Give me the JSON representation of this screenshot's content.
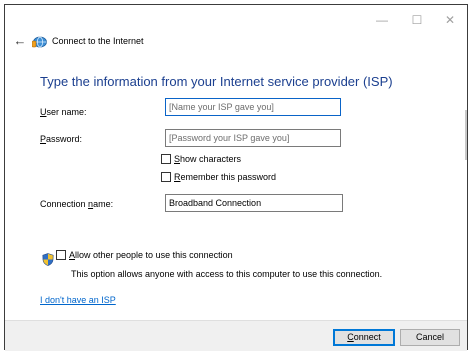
{
  "titlebar": {
    "minimize_glyph": "—",
    "maximize_glyph": "☐",
    "close_glyph": "✕"
  },
  "nav": {
    "back_glyph": "←",
    "icon": "network-globe-icon",
    "title": "Connect to the Internet"
  },
  "heading": "Type the information from your Internet service provider (ISP)",
  "form": {
    "username": {
      "label_accel": "U",
      "label_rest": "ser name:",
      "placeholder": "[Name your ISP gave you]",
      "value": ""
    },
    "password": {
      "label_accel": "P",
      "label_rest": "assword:",
      "placeholder": "[Password your ISP gave you]",
      "value": ""
    },
    "show_characters": {
      "label_accel": "S",
      "label_rest": "how characters",
      "checked": false
    },
    "remember_password": {
      "label_accel": "R",
      "label_rest": "emember this password",
      "checked": false
    },
    "connection_name": {
      "label_pre": "Connection ",
      "label_accel": "n",
      "label_rest": "ame:",
      "value": "Broadband Connection"
    }
  },
  "sharing": {
    "icon": "uac-shield-icon",
    "label_accel": "A",
    "label_rest": "llow other people to use this connection",
    "checked": false,
    "description": "This option allows anyone with access to this computer to use this connection."
  },
  "no_isp_link": "I don't have an ISP",
  "buttons": {
    "connect_accel": "C",
    "connect_rest": "onnect",
    "cancel": "Cancel"
  },
  "colors": {
    "heading": "#1b3f8f",
    "link": "#0066cc",
    "focus_border": "#0a64c8",
    "footer_bg": "#f0f0f0",
    "primary_button_border": "#0078d7"
  }
}
